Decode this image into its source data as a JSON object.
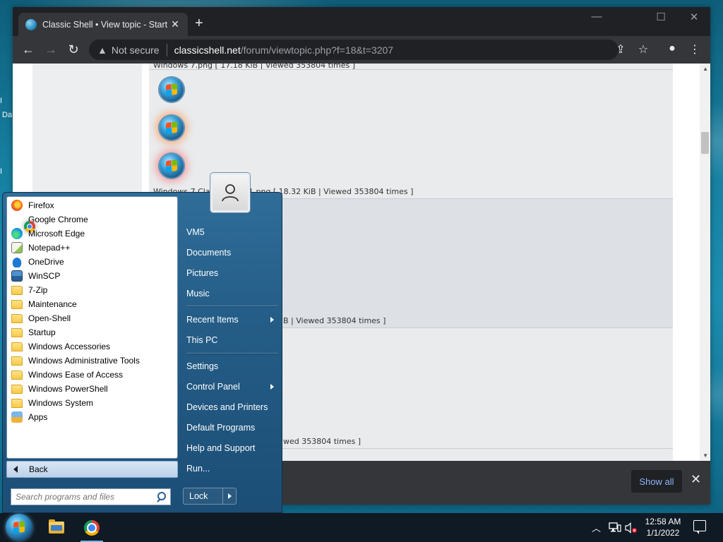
{
  "desktop": {
    "icon_fragment_1": "I",
    "icon_fragment_2": "Da",
    "icon_fragment_3": "I"
  },
  "browser": {
    "tab_title": "Classic Shell • View topic - Start I",
    "security_label": "Not secure",
    "url_host": "classicshell.net",
    "url_path": "/forum/viewtopic.php?f=18&t=3207",
    "window_minimize": "—",
    "window_maximize": "☐",
    "window_close": "✕",
    "newtab": "+",
    "back": "←",
    "forward": "→",
    "reload": "↻",
    "share": "⇪",
    "bookmark": "☆",
    "profile": "●",
    "menu": "⋮",
    "tab_close": "✕"
  },
  "page": {
    "caption_top": "Windows 7.png [ 17.18 KiB | Viewed 353804 times ]",
    "caption_mid1": "Windows 7 Classic Shell 1.png [ 18.32 KiB | Viewed 353804 times ]",
    "caption_mid2": "B | Viewed 353804 times ]",
    "caption_bottom": "wed 353804 times ]"
  },
  "download_bar": {
    "show_all": "Show all",
    "close": "✕"
  },
  "start_menu": {
    "programs": [
      {
        "label": "Firefox",
        "icon": "ff"
      },
      {
        "label": "Google Chrome",
        "icon": "chrome"
      },
      {
        "label": "Microsoft Edge",
        "icon": "edge"
      },
      {
        "label": "Notepad++",
        "icon": "npp"
      },
      {
        "label": "OneDrive",
        "icon": "onedrive"
      },
      {
        "label": "WinSCP",
        "icon": "winscp"
      },
      {
        "label": "7-Zip",
        "icon": "folder"
      },
      {
        "label": "Maintenance",
        "icon": "folder"
      },
      {
        "label": "Open-Shell",
        "icon": "folder"
      },
      {
        "label": "Startup",
        "icon": "folder"
      },
      {
        "label": "Windows Accessories",
        "icon": "folder"
      },
      {
        "label": "Windows Administrative Tools",
        "icon": "folder"
      },
      {
        "label": "Windows Ease of Access",
        "icon": "folder"
      },
      {
        "label": "Windows PowerShell",
        "icon": "folder"
      },
      {
        "label": "Windows System",
        "icon": "folder"
      },
      {
        "label": "Apps",
        "icon": "apps"
      }
    ],
    "back_label": "Back",
    "search_placeholder": "Search programs and files",
    "right_items": [
      {
        "label": "VM5",
        "submenu": false
      },
      {
        "label": "Documents",
        "submenu": false
      },
      {
        "label": "Pictures",
        "submenu": false
      },
      {
        "label": "Music",
        "submenu": false
      },
      {
        "label": "Recent Items",
        "submenu": true
      },
      {
        "label": "This PC",
        "submenu": false
      },
      {
        "label": "Settings",
        "submenu": false
      },
      {
        "label": "Control Panel",
        "submenu": true
      },
      {
        "label": "Devices and Printers",
        "submenu": false
      },
      {
        "label": "Default Programs",
        "submenu": false
      },
      {
        "label": "Help and Support",
        "submenu": false
      },
      {
        "label": "Run...",
        "submenu": false
      }
    ],
    "lock_label": "Lock"
  },
  "taskbar": {
    "tray_chevron": "︿",
    "time": "12:58 AM",
    "date": "1/1/2022"
  }
}
